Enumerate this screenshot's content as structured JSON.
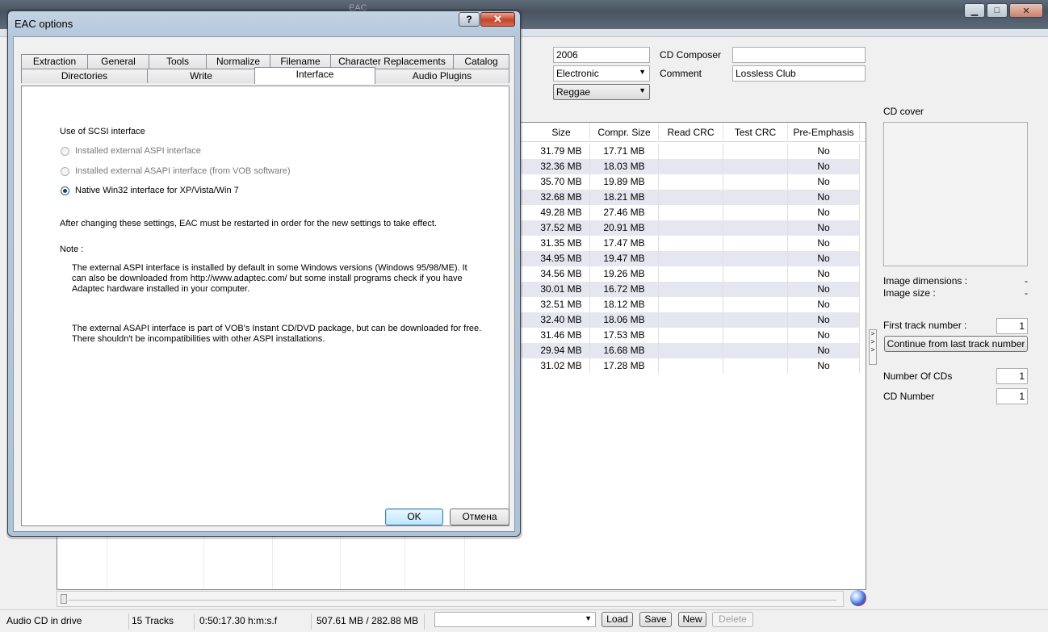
{
  "main_window": {
    "title": "EAC",
    "buttons": {
      "minimize": "▁",
      "maximize": "□",
      "close": "✕"
    },
    "metadata": {
      "year_value": "2006",
      "genre_value": "Electronic",
      "freedb_genre_value": "Reggae",
      "composer_label": "CD Composer",
      "composer_value": "",
      "comment_label": "Comment",
      "comment_value": "Lossless Club"
    },
    "table": {
      "columns": [
        "Size",
        "Compr. Size",
        "Read CRC",
        "Test CRC",
        "Pre-Emphasis"
      ],
      "rows": [
        {
          "size": "31.79 MB",
          "compr": "17.71 MB",
          "read_crc": "",
          "test_crc": "",
          "pre": "No"
        },
        {
          "size": "32.36 MB",
          "compr": "18.03 MB",
          "read_crc": "",
          "test_crc": "",
          "pre": "No"
        },
        {
          "size": "35.70 MB",
          "compr": "19.89 MB",
          "read_crc": "",
          "test_crc": "",
          "pre": "No"
        },
        {
          "size": "32.68 MB",
          "compr": "18.21 MB",
          "read_crc": "",
          "test_crc": "",
          "pre": "No"
        },
        {
          "size": "49.28 MB",
          "compr": "27.46 MB",
          "read_crc": "",
          "test_crc": "",
          "pre": "No"
        },
        {
          "size": "37.52 MB",
          "compr": "20.91 MB",
          "read_crc": "",
          "test_crc": "",
          "pre": "No"
        },
        {
          "size": "31.35 MB",
          "compr": "17.47 MB",
          "read_crc": "",
          "test_crc": "",
          "pre": "No"
        },
        {
          "size": "34.95 MB",
          "compr": "19.47 MB",
          "read_crc": "",
          "test_crc": "",
          "pre": "No"
        },
        {
          "size": "34.56 MB",
          "compr": "19.26 MB",
          "read_crc": "",
          "test_crc": "",
          "pre": "No"
        },
        {
          "size": "30.01 MB",
          "compr": "16.72 MB",
          "read_crc": "",
          "test_crc": "",
          "pre": "No"
        },
        {
          "size": "32.51 MB",
          "compr": "18.12 MB",
          "read_crc": "",
          "test_crc": "",
          "pre": "No"
        },
        {
          "size": "32.40 MB",
          "compr": "18.06 MB",
          "read_crc": "",
          "test_crc": "",
          "pre": "No"
        },
        {
          "size": "31.46 MB",
          "compr": "17.53 MB",
          "read_crc": "",
          "test_crc": "",
          "pre": "No"
        },
        {
          "size": "29.94 MB",
          "compr": "16.68 MB",
          "read_crc": "",
          "test_crc": "",
          "pre": "No"
        },
        {
          "size": "31.02 MB",
          "compr": "17.28 MB",
          "read_crc": "",
          "test_crc": "",
          "pre": "No"
        }
      ]
    },
    "side_panel": {
      "cd_cover_label": "CD cover",
      "image_dimensions_label": "Image dimensions :",
      "image_dimensions_value": "-",
      "image_size_label": "Image size :",
      "image_size_value": "-",
      "first_track_label": "First track number :",
      "first_track_value": "1",
      "continue_button": "Continue from last track number",
      "number_of_cds_label": "Number Of CDs",
      "number_of_cds_value": "1",
      "cd_number_label": "CD Number",
      "cd_number_value": "1",
      "toggle_glyph": "> > >"
    },
    "status_bar": {
      "drive_status": "Audio CD in drive",
      "tracks": "15 Tracks",
      "duration": "0:50:17.30 h:m:s.f",
      "sizes": "507.61 MB / 282.88 MB",
      "profile_value": "",
      "load": "Load",
      "save": "Save",
      "new": "New",
      "delete": "Delete"
    }
  },
  "dialog": {
    "title": "EAC options",
    "help_glyph": "?",
    "close_glyph": "✕",
    "tabs_row1": [
      "Extraction",
      "General",
      "Tools",
      "Normalize",
      "Filename",
      "Character Replacements",
      "Catalog"
    ],
    "tabs_row2": [
      "Directories",
      "Write",
      "Interface",
      "Audio Plugins"
    ],
    "active_tab": "Interface",
    "scsi_heading": "Use of SCSI interface",
    "options": [
      {
        "label": "Installed external ASPI interface",
        "selected": false,
        "enabled": false
      },
      {
        "label": "Installed external ASAPI interface (from VOB software)",
        "selected": false,
        "enabled": false
      },
      {
        "label": "Native Win32 interface for XP/Vista/Win 7",
        "selected": true,
        "enabled": true
      }
    ],
    "restart_note": "After changing these settings, EAC must be restarted in order for the new settings to take effect.",
    "note_label": "Note :",
    "note_aspi": "The external ASPI interface is installed by default in some Windows versions (Windows 95/98/ME). It can also be downloaded from http://www.adaptec.com/ but some install programs check if you have Adaptec hardware installed in your computer.",
    "note_asapi": "The external ASAPI interface is part of VOB's Instant CD/DVD package, but can be downloaded for free. There shouldn't be incompatibilities with other ASPI installations.",
    "ok": "OK",
    "cancel": "Отмена"
  }
}
